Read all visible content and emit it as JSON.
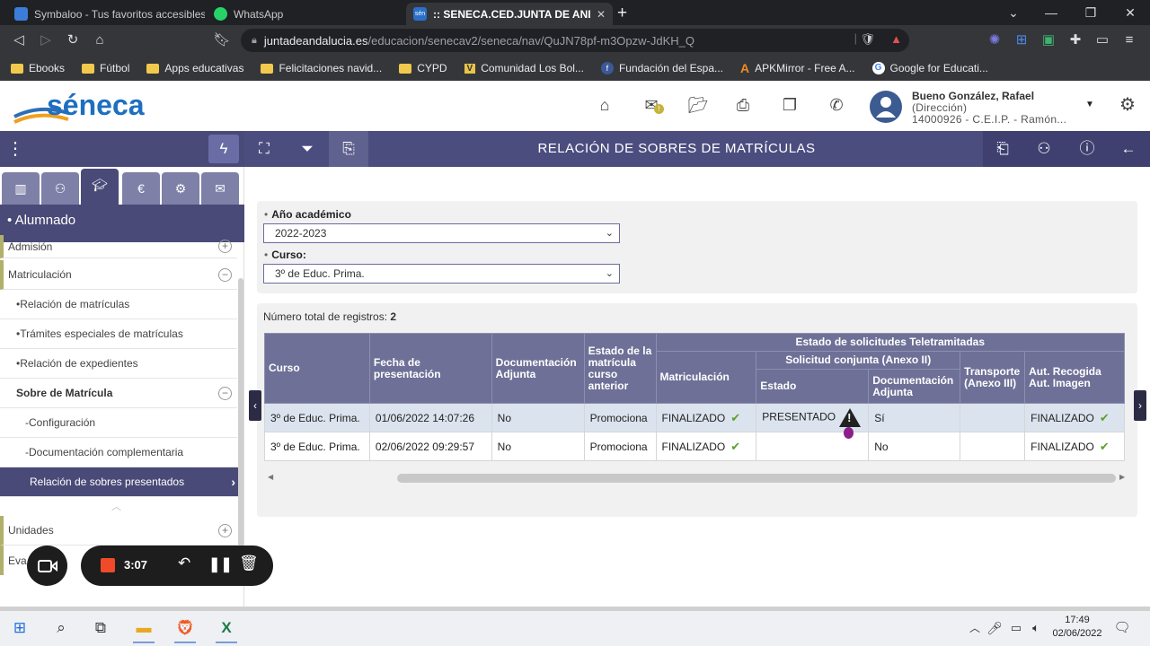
{
  "browser": {
    "tabs": [
      {
        "title": "Symbaloo - Tus favoritos accesibles de"
      },
      {
        "title": "WhatsApp"
      },
      {
        "title": ":: SENECA.CED.JUNTA DE ANDALU"
      }
    ],
    "url_host": "juntadeandalucia.es",
    "url_path": "/educacion/senecav2/seneca/nav/QuJN78pf-m3Opzw-JdKH_Q",
    "bookmarks": [
      "Ebooks",
      "Fútbol",
      "Apps educativas",
      "Felicitaciones navid...",
      "CYPD",
      "Comunidad Los Bol...",
      "Fundación del Espa...",
      "APKMirror - Free A...",
      "Google for Educati..."
    ]
  },
  "app": {
    "logo_text": "séneca",
    "user_name": "Bueno González, Rafael",
    "user_role": "(Dirección)",
    "user_center": "14000926 - C.E.I.P. - Ramón...",
    "page_title": "RELACIÓN DE SOBRES DE MATRÍCULAS",
    "colors": {
      "purple_dark": "#4a4a78",
      "purple_bar": "#4b4d7f",
      "header_cell": "#6e7097",
      "row_highlight": "#dbe4ee"
    }
  },
  "sidebar": {
    "section_title": "• Alumnado",
    "items": [
      {
        "label": "Admisión",
        "toggle": "+"
      },
      {
        "label": "Matriculación",
        "toggle": "−"
      },
      {
        "label": "•Relación de matrículas"
      },
      {
        "label": "•Trámites especiales de matrículas"
      },
      {
        "label": "•Relación de expedientes"
      },
      {
        "label": "Sobre de Matrícula",
        "toggle": "−"
      },
      {
        "label": "-Configuración"
      },
      {
        "label": "-Documentación complementaria"
      },
      {
        "label": "Relación de sobres presentados"
      },
      {
        "label": "Unidades",
        "toggle": "+"
      },
      {
        "label": "Eva"
      }
    ]
  },
  "filters": {
    "year_label": "Año académico",
    "year_value": "2022-2023",
    "course_label": "Curso:",
    "course_value": "3º de Educ. Prima."
  },
  "results": {
    "total_label": "Número total de registros:",
    "total_value": "2",
    "headers": {
      "curso": "Curso",
      "fecha": "Fecha de presentación",
      "doc": "Documentación Adjunta",
      "estado_ant": "Estado de la matrícula curso anterior",
      "group": "Estado de solicitudes Teletramitadas",
      "matric": "Matriculación",
      "conjunta": "Solicitud conjunta (Anexo II)",
      "estado": "Estado",
      "doc_adj": "Documentación Adjunta",
      "transporte": "Transporte (Anexo III)",
      "aut": "Aut. Recogida Aut. Imagen"
    },
    "rows": [
      {
        "curso": "3º de Educ. Prima.",
        "fecha": "01/06/2022 14:07:26",
        "doc": "No",
        "estado_ant": "Promociona",
        "matric": "FINALIZADO",
        "estado": "PRESENTADO",
        "doc_adj": "Sí",
        "transporte": "",
        "aut": "FINALIZADO"
      },
      {
        "curso": "3º de Educ. Prima.",
        "fecha": "02/06/2022 09:29:57",
        "doc": "No",
        "estado_ant": "Promociona",
        "matric": "FINALIZADO",
        "estado": "",
        "doc_adj": "No",
        "transporte": "",
        "aut": "FINALIZADO"
      }
    ]
  },
  "recorder": {
    "time": "3:07"
  },
  "taskbar": {
    "time": "17:49",
    "date": "02/06/2022"
  }
}
